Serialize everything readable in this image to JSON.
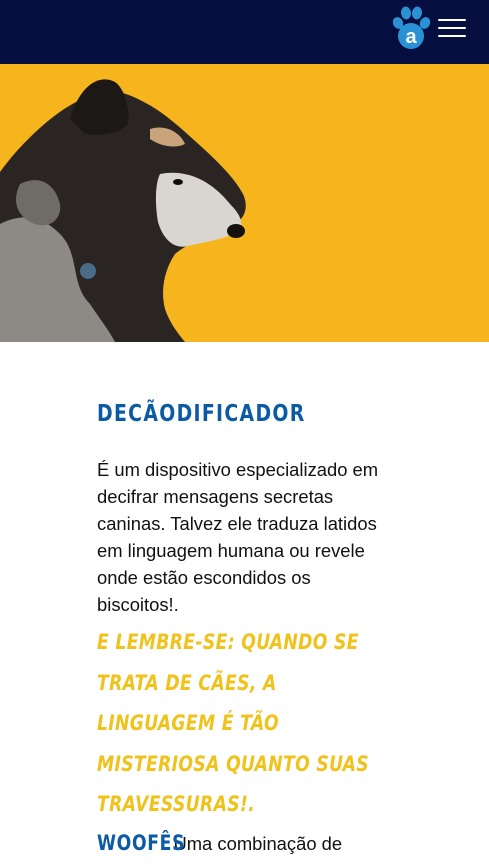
{
  "header": {
    "logo_letter": "a",
    "logo_icon": "paw-logo-icon",
    "menu_icon": "hamburger-menu-icon",
    "background": "#050e3e",
    "logo_color": "#2a92d4"
  },
  "hero": {
    "background": "#f7b51d",
    "subject": "dog-photo"
  },
  "article": {
    "title": "DECÃODIFICADOR",
    "description": "É um dispositivo especializado em decifrar mensagens secretas caninas. Talvez ele traduza latidos em linguagem humana ou revele onde estão escondidos os biscoitos!.",
    "quote": "E LEMBRE-SE: QUANDO SE TRATA DE CÃES, A LINGUAGEM É TÃO MISTERIOSA QUANTO SUAS TRAVESSURAS!.",
    "term": "WOOFÊS",
    "term_text": "Uma combinação de"
  },
  "colors": {
    "title": "#0b5aa6",
    "quote": "#efc21c",
    "text": "#111111"
  }
}
